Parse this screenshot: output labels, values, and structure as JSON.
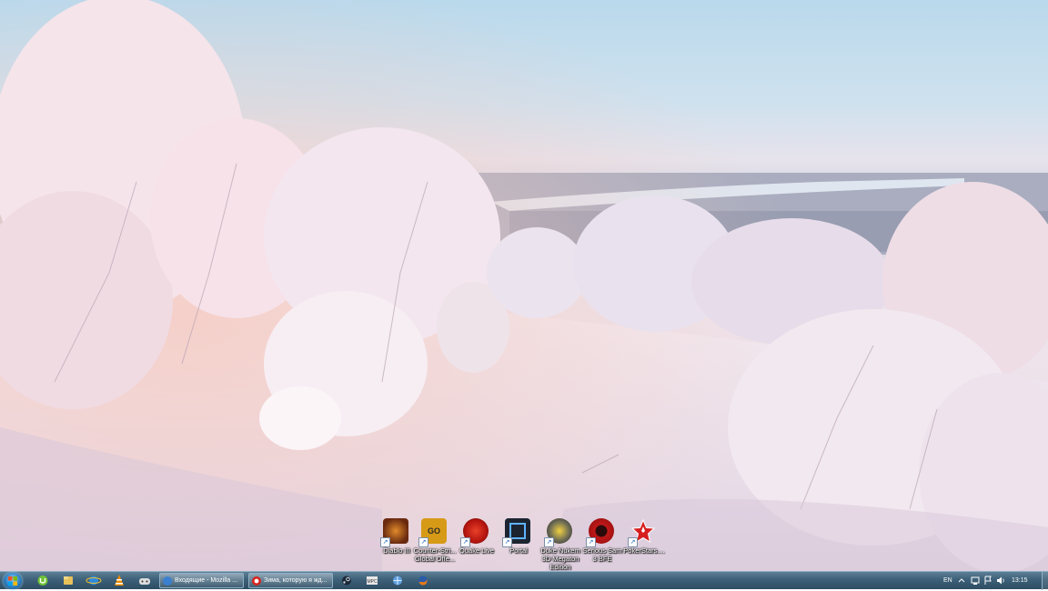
{
  "desktop": {
    "icons": [
      {
        "label": "Diablo III",
        "icon": "diablo-icon",
        "color": "#6a2a10"
      },
      {
        "label": "Counter-Stri...\nGlobal Offe...",
        "icon": "csgo-icon",
        "color": "#d79a16"
      },
      {
        "label": "Quake Live",
        "icon": "quake-icon",
        "color": "#b3140e"
      },
      {
        "label": "Portal",
        "icon": "portal-icon",
        "color": "#1c2430"
      },
      {
        "label": "Duke Nukem\n3D Megaton\nEdition",
        "icon": "duke-nukem-icon",
        "color": "#6b6a55"
      },
      {
        "label": "Serious Sam\n3 BFE",
        "icon": "serious-sam-icon",
        "color": "#c01818"
      },
      {
        "label": "PokerStars....",
        "icon": "pokerstars-icon",
        "color": "#d61e1e"
      }
    ]
  },
  "taskbar": {
    "pinned": [
      {
        "name": "utorrent-icon",
        "color": "#6fc236"
      },
      {
        "name": "explorer-icon",
        "color": "#e8c15a"
      },
      {
        "name": "internet-explorer-icon",
        "color": "#2c8ae0"
      },
      {
        "name": "vlc-icon",
        "color": "#f08a00"
      },
      {
        "name": "game-controller-icon",
        "color": "#dddddd"
      }
    ],
    "tasks": [
      {
        "label": "Входящие - Mozilla ...",
        "icon": "thunderbird-icon",
        "color": "#3b7fd0"
      },
      {
        "label": "Зима, которую я жд...",
        "icon": "opera-icon",
        "color": "#d8231c"
      }
    ],
    "pinned_after": [
      {
        "name": "steam-icon",
        "color": "#cfd8e0"
      },
      {
        "name": "media-player-classic-icon",
        "color": "#e8e8e8"
      },
      {
        "name": "browser-icon",
        "color": "#5fa0e0"
      },
      {
        "name": "firefox-icon",
        "color": "#e87a18"
      }
    ],
    "tray": {
      "language": "EN",
      "clock": "13:15"
    }
  }
}
